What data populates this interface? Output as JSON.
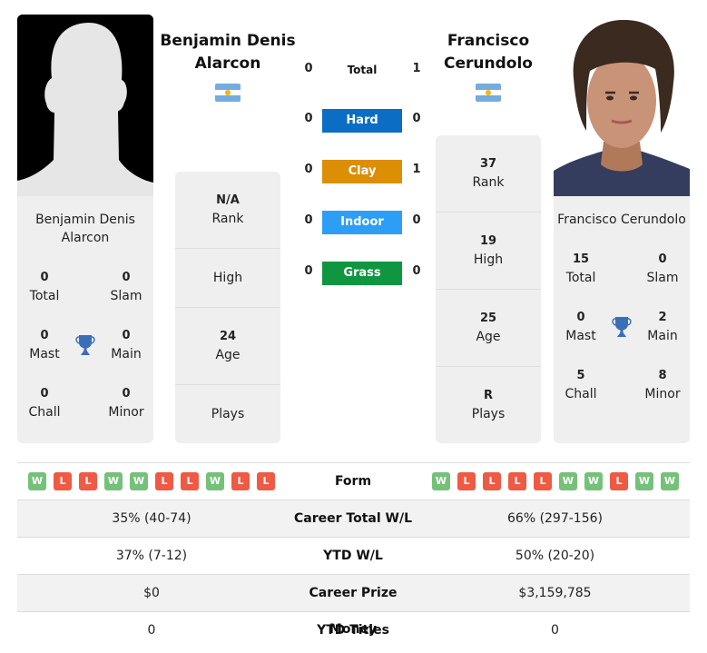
{
  "players": {
    "left": {
      "name": "Benjamin Denis Alarcon",
      "name_line1": "Benjamin Denis",
      "name_line2": "Alarcon",
      "card_name_line1": "Benjamin Denis",
      "card_name_line2": "Alarcon",
      "country": "Argentina",
      "photo": "silhouette-placeholder",
      "titles": {
        "total": {
          "value": "0",
          "label": "Total"
        },
        "slam": {
          "value": "0",
          "label": "Slam"
        },
        "mast": {
          "value": "0",
          "label": "Mast"
        },
        "main": {
          "value": "0",
          "label": "Main"
        },
        "chall": {
          "value": "0",
          "label": "Chall"
        },
        "minor": {
          "value": "0",
          "label": "Minor"
        }
      },
      "rank": {
        "value": "N/A",
        "label": "Rank"
      },
      "high": {
        "value": "",
        "label": "High"
      },
      "age": {
        "value": "24",
        "label": "Age"
      },
      "plays": {
        "value": "",
        "label": "Plays"
      }
    },
    "right": {
      "name": "Francisco Cerundolo",
      "name_line1": "Francisco",
      "name_line2": "Cerundolo",
      "card_name": "Francisco Cerundolo",
      "country": "Argentina",
      "photo": "player-portrait",
      "titles": {
        "total": {
          "value": "15",
          "label": "Total"
        },
        "slam": {
          "value": "0",
          "label": "Slam"
        },
        "mast": {
          "value": "0",
          "label": "Mast"
        },
        "main": {
          "value": "2",
          "label": "Main"
        },
        "chall": {
          "value": "5",
          "label": "Chall"
        },
        "minor": {
          "value": "8",
          "label": "Minor"
        }
      },
      "rank": {
        "value": "37",
        "label": "Rank"
      },
      "high": {
        "value": "19",
        "label": "High"
      },
      "age": {
        "value": "25",
        "label": "Age"
      },
      "plays": {
        "value": "R",
        "label": "Plays"
      }
    }
  },
  "h2h": {
    "total": {
      "label": "Total",
      "left": "0",
      "right": "1"
    },
    "surfaces": [
      {
        "label": "Hard",
        "left": "0",
        "right": "0",
        "color": "#0b6ec4"
      },
      {
        "label": "Clay",
        "left": "0",
        "right": "1",
        "color": "#dc8e05"
      },
      {
        "label": "Indoor",
        "left": "0",
        "right": "0",
        "color": "#2d9ef5"
      },
      {
        "label": "Grass",
        "left": "0",
        "right": "0",
        "color": "#109641"
      }
    ]
  },
  "icons": {
    "trophy": "trophy-icon",
    "flag": "argentina-flag-icon"
  },
  "comparison": {
    "form": {
      "label": "Form",
      "left": [
        "W",
        "L",
        "L",
        "W",
        "W",
        "L",
        "L",
        "W",
        "L",
        "L"
      ],
      "right": [
        "W",
        "L",
        "L",
        "L",
        "L",
        "W",
        "W",
        "L",
        "W",
        "W"
      ]
    },
    "rows": [
      {
        "label": "Career Total W/L",
        "left": "35% (40-74)",
        "right": "66% (297-156)"
      },
      {
        "label": "YTD W/L",
        "left": "37% (7-12)",
        "right": "50% (20-20)"
      },
      {
        "label": "Career Prize Money",
        "left": "$0",
        "right": "$3,159,785"
      },
      {
        "label": "YTD Titles",
        "left": "0",
        "right": "0"
      }
    ]
  },
  "colors": {
    "win": "#76c17a",
    "loss": "#ee5a44",
    "trophy": "#3a6fb8",
    "card_bg": "#efefef"
  }
}
